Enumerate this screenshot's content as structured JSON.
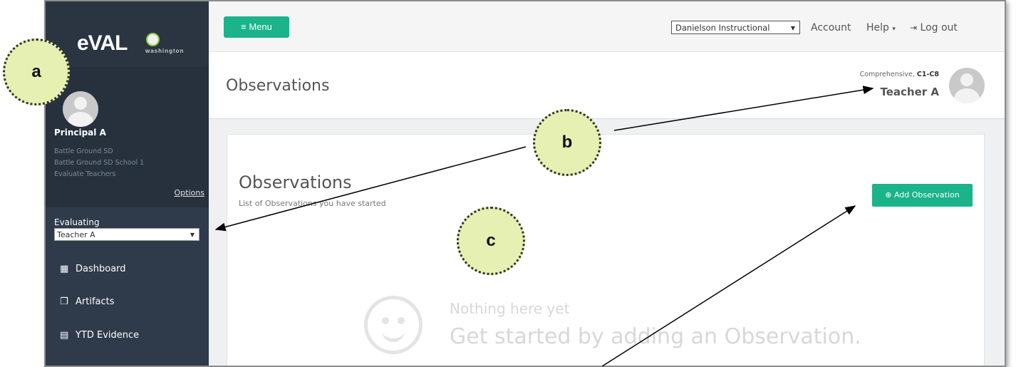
{
  "sidebar": {
    "logo_text": "eVAL",
    "logo_sub": "washington",
    "user_name": "Principal A",
    "user_district": "Battle Ground SD",
    "user_school": "Battle Ground SD School 1",
    "user_role": "Evaluate Teachers",
    "options_label": "Options",
    "evaluating_label": "Evaluating",
    "evaluating_value": "Teacher A",
    "nav": [
      {
        "label": "Dashboard",
        "icon": "dashboard-icon"
      },
      {
        "label": "Artifacts",
        "icon": "artifacts-icon"
      },
      {
        "label": "YTD Evidence",
        "icon": "table-icon"
      }
    ]
  },
  "topbar": {
    "menu_label": "Menu",
    "framework_value": "Danielson Instructional",
    "account_label": "Account",
    "help_label": "Help",
    "logout_label": "Log out"
  },
  "header": {
    "page_title": "Observations",
    "eval_type_prefix": "Comprehensive,",
    "eval_type_code": "C1-C8",
    "evaluatee": "Teacher A"
  },
  "card": {
    "title": "Observations",
    "subtitle": "List of Observations you have started",
    "add_button": "Add Observation",
    "empty_title": "Nothing here yet",
    "empty_subtitle": "Get started by adding an Observation."
  },
  "callouts": [
    "a",
    "b",
    "c"
  ],
  "colors": {
    "sidebar": "#2f3b4a",
    "accent": "#1ab38a",
    "callout_fill": "#e6f0b2"
  }
}
